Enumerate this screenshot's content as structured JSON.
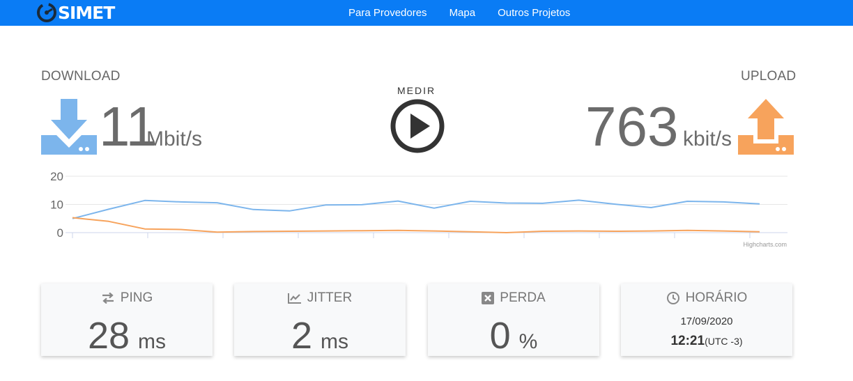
{
  "nav": {
    "logo_text": "SIMET",
    "links": [
      "Para Provedores",
      "Mapa",
      "Outros Projetos"
    ]
  },
  "download": {
    "label": "DOWNLOAD",
    "value": "11",
    "unit": "Mbit/s"
  },
  "upload": {
    "label": "UPLOAD",
    "value": "763",
    "unit": "kbit/s"
  },
  "measure": {
    "label": "MEDIR"
  },
  "chart_data": {
    "type": "line",
    "y_ticks": [
      "20",
      "10",
      "0"
    ],
    "ylim": [
      0,
      20
    ],
    "credit": "Highcharts.com",
    "grid": true,
    "series": [
      {
        "color": "#7cb5ec",
        "values": [
          5.0,
          8.3,
          11.4,
          10.9,
          10.6,
          8.2,
          7.7,
          9.8,
          9.9,
          11.2,
          8.7,
          11.1,
          10.5,
          10.4,
          11.5,
          10.1,
          8.9,
          11.1,
          10.9,
          10.2
        ]
      },
      {
        "color": "#f7a35c",
        "values": [
          5.3,
          4.0,
          1.3,
          1.1,
          0.2,
          0.4,
          0.5,
          0.6,
          0.7,
          0.8,
          0.6,
          0.3,
          0.0,
          0.5,
          0.6,
          0.5,
          0.6,
          0.8,
          0.6,
          0.3
        ]
      }
    ]
  },
  "cards": {
    "ping": {
      "label": "PING",
      "value": "28",
      "unit": "ms"
    },
    "jitter": {
      "label": "JITTER",
      "value": "2",
      "unit": "ms"
    },
    "perda": {
      "label": "PERDA",
      "value": "0",
      "unit": "%"
    },
    "horario": {
      "label": "HORÁRIO",
      "date": "17/09/2020",
      "time": "12:21",
      "tz": "(UTC -3)"
    }
  }
}
